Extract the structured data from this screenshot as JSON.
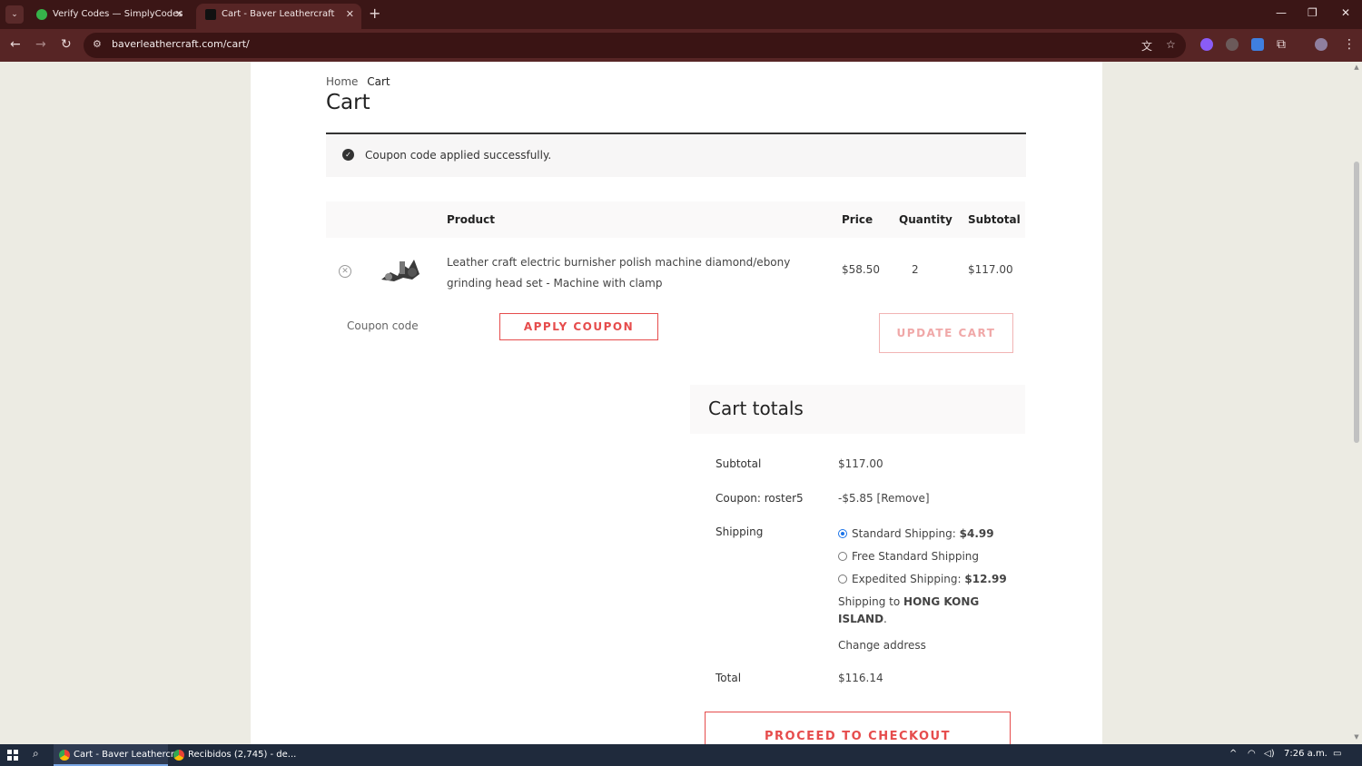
{
  "browser": {
    "tabs": [
      {
        "title": "Verify Codes — SimplyCodes",
        "active": false
      },
      {
        "title": "Cart - Baver Leathercraft",
        "active": true
      }
    ],
    "url": "baverleathercraft.com/cart/"
  },
  "breadcrumb": {
    "home": "Home",
    "current": "Cart"
  },
  "page_title": "Cart",
  "notice": {
    "message": "Coupon code applied successfully."
  },
  "table": {
    "headers": {
      "product": "Product",
      "price": "Price",
      "quantity": "Quantity",
      "subtotal": "Subtotal"
    },
    "rows": [
      {
        "name": "Leather craft electric burnisher polish machine diamond/ebony grinding head set - Machine with clamp",
        "price": "$58.50",
        "quantity": "2",
        "subtotal": "$117.00"
      }
    ]
  },
  "coupon": {
    "placeholder": "Coupon code",
    "apply_label": "APPLY COUPON",
    "update_label": "UPDATE CART"
  },
  "totals": {
    "title": "Cart totals",
    "subtotal_label": "Subtotal",
    "subtotal_value": "$117.00",
    "coupon_label": "Coupon: roster5",
    "coupon_value": "-$5.85",
    "coupon_remove": "[Remove]",
    "shipping_label": "Shipping",
    "shipping_options": [
      {
        "label": "Standard Shipping:",
        "price": "$4.99",
        "selected": true
      },
      {
        "label": "Free Standard Shipping",
        "price": "",
        "selected": false
      },
      {
        "label": "Expedited Shipping:",
        "price": "$12.99",
        "selected": false
      }
    ],
    "shipping_to_prefix": "Shipping to",
    "shipping_to_place": "HONG KONG ISLAND",
    "change_address": "Change address",
    "total_label": "Total",
    "total_value": "$116.14",
    "checkout_label": "PROCEED TO CHECKOUT"
  },
  "taskbar": {
    "apps": [
      {
        "title": "Cart - Baver Leathercr...",
        "active": true
      },
      {
        "title": "Recibidos (2,745) - de...",
        "active": false
      }
    ],
    "time": "7:26 a.m."
  },
  "colors": {
    "accent": "#e64c4c",
    "browser_frame": "#572525",
    "page_bg": "#ecebe3"
  }
}
